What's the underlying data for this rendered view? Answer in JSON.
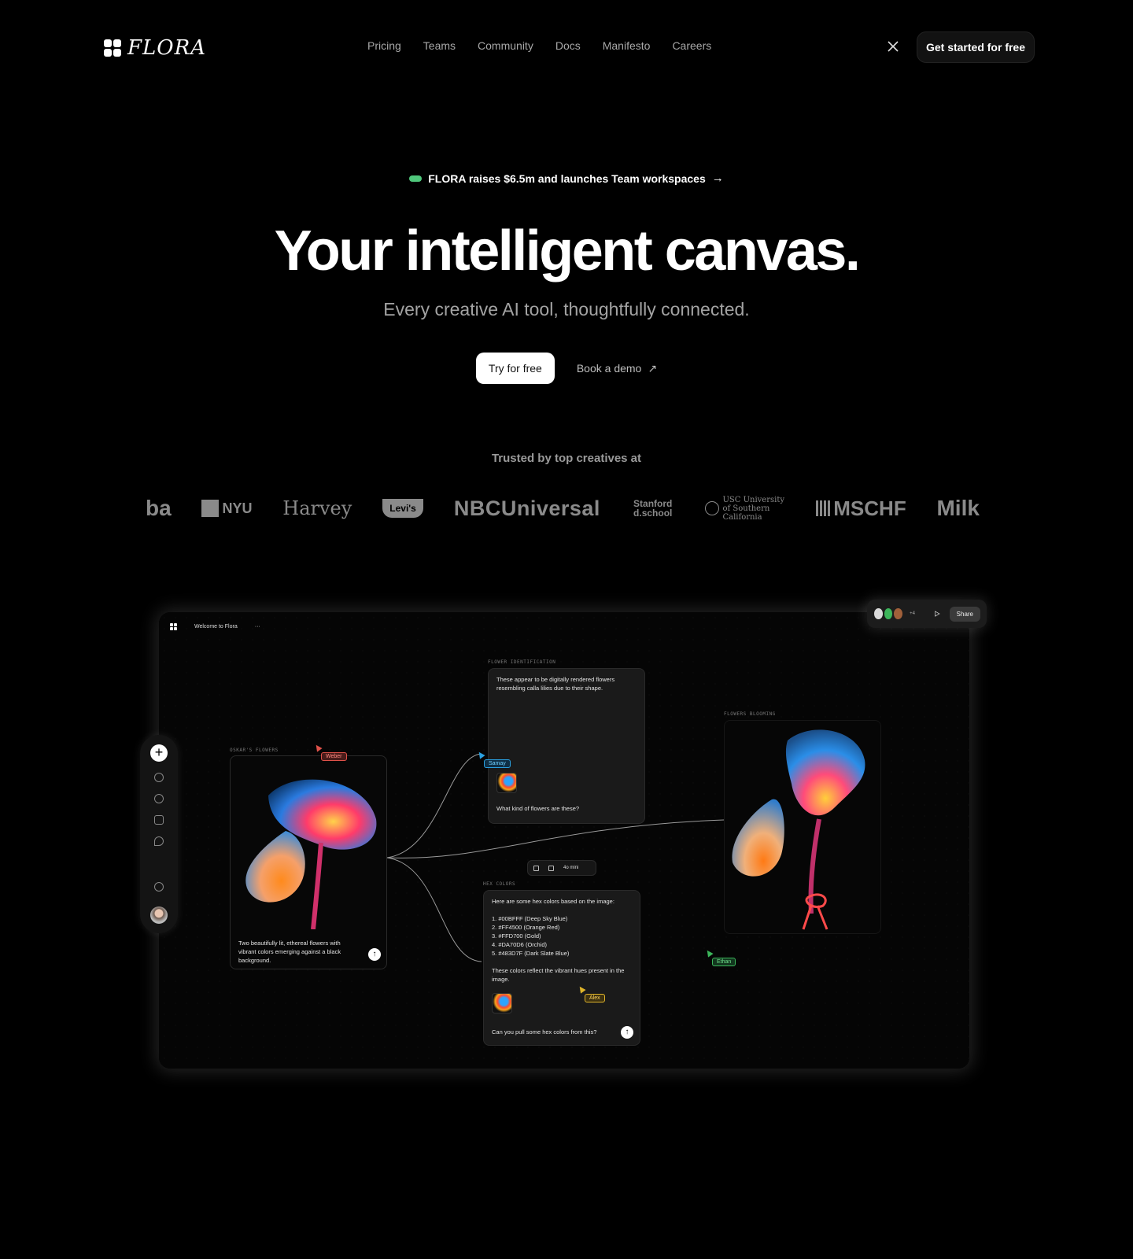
{
  "nav": {
    "logo_text": "FLORA",
    "links": [
      "Pricing",
      "Teams",
      "Community",
      "Docs",
      "Manifesto",
      "Careers"
    ],
    "x_icon": "x-logo-icon",
    "cta": "Get started for free"
  },
  "hero": {
    "announcement": "FLORA raises $6.5m and launches Team workspaces",
    "announcement_arrow": "→",
    "title": "Your intelligent canvas.",
    "subtitle": "Every creative AI tool, thoughtfully connected.",
    "primary_button": "Try for free",
    "secondary_button": "Book a demo",
    "secondary_arrow": "↗"
  },
  "trust": {
    "heading": "Trusted by top creatives at",
    "logos": [
      "ba",
      "NYU",
      "Harvey",
      "Levi's",
      "NBCUniversal",
      "Stanford d.school",
      "USC University of Southern California",
      "MSCHF",
      "Milk"
    ]
  },
  "app": {
    "project_title": "Welcome to Flora",
    "menu_dots": "···",
    "share": {
      "extra_count": "+4",
      "button": "Share"
    },
    "nodes": {
      "oskar": {
        "label": "OSKAR'S FLOWERS",
        "caption": "Two beautifully lit, ethereal flowers with vibrant colors emerging against a black background."
      },
      "identification": {
        "label": "FLOWER IDENTIFICATION",
        "answer": "These appear to be digitally rendered flowers resembling calla lilies due to their shape.",
        "prompt": "What kind of flowers are these?"
      },
      "blooming": {
        "label": "FLOWERS BLOOMING"
      },
      "hex": {
        "label": "HEX COLORS",
        "intro": "Here are some hex colors based on the image:",
        "colors": [
          "1. #00BFFF (Deep Sky Blue)",
          "2. #FF4500 (Orange Red)",
          "3. #FFD700 (Gold)",
          "4. #DA70D6 (Orchid)",
          "5. #483D7F (Dark Slate Blue)"
        ],
        "outro": "These colors reflect the vibrant hues present in the image.",
        "prompt": "Can you pull some hex colors from this?"
      }
    },
    "model_selector": "4o mini",
    "cursors": [
      {
        "name": "Weber",
        "color": "#e0524a"
      },
      {
        "name": "Samay",
        "color": "#2aa0e0"
      },
      {
        "name": "Alex",
        "color": "#e0b52a"
      },
      {
        "name": "Ethan",
        "color": "#3cb55a"
      }
    ]
  },
  "colors": {
    "background": "#000000",
    "announce_pill": "#4fc77b",
    "muted_text": "#a3a3a3"
  }
}
